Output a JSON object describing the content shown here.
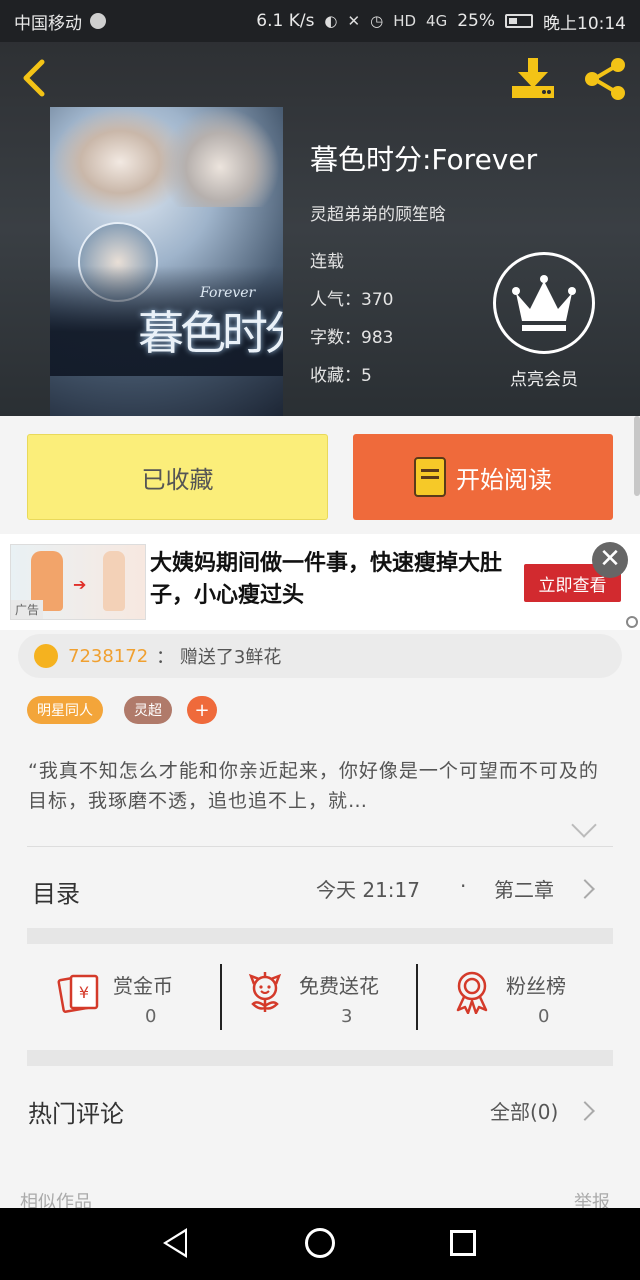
{
  "statusbar": {
    "carrier": "中国移动",
    "net_speed": "6.1 K/s",
    "signal_label": "4G",
    "hd_label": "HD",
    "battery": "25%",
    "time": "晚上10:14"
  },
  "book": {
    "title": "暮色时分:Forever",
    "author": "灵超弟弟的顾笙晗",
    "status": "连载",
    "popularity_label": "人气：",
    "popularity": "370",
    "words_label": "字数：",
    "words": "983",
    "favorites_label": "收藏：",
    "favorites": "5",
    "cover_title": "暮色时分",
    "cover_subtitle": "Forever"
  },
  "vip": {
    "label": "点亮会员"
  },
  "actions": {
    "favorite_label": "已收藏",
    "read_label": "开始阅读"
  },
  "ad": {
    "text": "大姨妈期间做一件事，快速瘦掉大肚子，小心瘦过头",
    "cta": "立即查看",
    "tag": "广告",
    "close": "✕"
  },
  "gift": {
    "user": "7238172",
    "message": "： 赠送了3鲜花"
  },
  "tags": [
    {
      "label": "明星同人",
      "color": "#f3a53a"
    },
    {
      "label": "灵超",
      "color": "#b07a6a"
    },
    {
      "label": "+",
      "color": "#ef6a3b"
    }
  ],
  "intro": "“我真不知怎么才能和你亲近起来，你好像是一个可望而不可及的目标，我琢磨不透，追也追不上，就…",
  "toc": {
    "label": "目录",
    "time": "今天 21:17",
    "separator": "·",
    "chapter": "第二章"
  },
  "stats": [
    {
      "label": "赏金币",
      "value": "0",
      "icon": "red-envelope-icon"
    },
    {
      "label": "免费送花",
      "value": "3",
      "icon": "flower-icon"
    },
    {
      "label": "粉丝榜",
      "value": "0",
      "icon": "medal-icon"
    }
  ],
  "comments": {
    "label": "热门评论",
    "all": "全部(0)"
  },
  "footer": {
    "similar": "相似作品",
    "report": "举报"
  },
  "colors": {
    "accent_yellow": "#f3c316",
    "read_orange": "#ef6a3b",
    "fav_yellow": "#fbee7a",
    "ad_red": "#d22a2f"
  }
}
